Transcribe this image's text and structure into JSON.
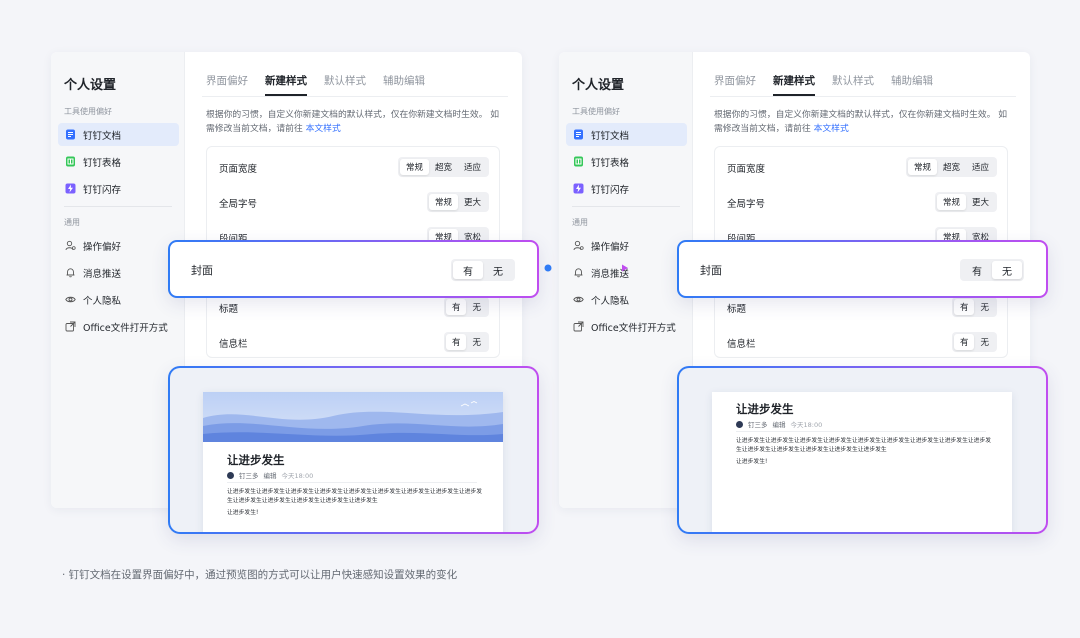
{
  "panels": {
    "sidebar": {
      "title": "个人设置",
      "group_tools": "工具使用偏好",
      "tool_items": [
        {
          "label": "钉钉文档",
          "icon": "doc-icon"
        },
        {
          "label": "钉钉表格",
          "icon": "sheet-icon"
        },
        {
          "label": "钉钉闪存",
          "icon": "flash-icon"
        }
      ],
      "group_general": "通用",
      "general_items": [
        {
          "label": "操作偏好",
          "icon": "user-preference-icon"
        },
        {
          "label": "消息推送",
          "icon": "bell-icon"
        },
        {
          "label": "个人隐私",
          "icon": "eye-icon"
        },
        {
          "label": "Office文件打开方式",
          "icon": "external-open-icon"
        }
      ]
    },
    "tabs": [
      "界面偏好",
      "新建样式",
      "默认样式",
      "辅助编辑"
    ],
    "active_tab": "新建样式",
    "description": "根据你的习惯，自定义你新建文档的默认样式，仅在你新建文档时生效。 如需修改当前文档，请前往",
    "description_link": "本文样式",
    "settings": {
      "page_width": {
        "label": "页面宽度",
        "options": [
          "常规",
          "超宽",
          "适应"
        ],
        "selected": "常规"
      },
      "font_size": {
        "label": "全局字号",
        "options": [
          "常规",
          "更大"
        ],
        "selected": "常规"
      },
      "paragraph": {
        "label": "段间距",
        "options": [
          "常规",
          "宽松"
        ],
        "selected": "常规"
      },
      "heading": {
        "label": "标题",
        "options": [
          "有",
          "无"
        ],
        "selected": "有"
      },
      "infobar": {
        "label": "信息栏",
        "options": [
          "有",
          "无"
        ],
        "selected": "有"
      }
    },
    "cover": {
      "label": "封面",
      "options": [
        "有",
        "无"
      ]
    }
  },
  "left_state": {
    "cover_selected": "有"
  },
  "right_state": {
    "cover_selected": "无"
  },
  "preview": {
    "title": "让进步发生",
    "author": "钉三多",
    "edit_label": "编辑",
    "time": "今天18:00",
    "body_line": "让进步发生让进步发生让进步发生让进步发生让进步发生让进步发生让进步发生让进步发生让进步发生让进步发生让进步发生让进步发生让进步发生让进步发生",
    "body_end": "让进步发生!"
  },
  "colors": {
    "accent": "#3370ff",
    "highlight_start": "#2f7bf5",
    "highlight_end": "#c04df0"
  },
  "footnote": "·  钉钉文档在设置界面偏好中，通过预览图的方式可以让用户快速感知设置效果的变化"
}
